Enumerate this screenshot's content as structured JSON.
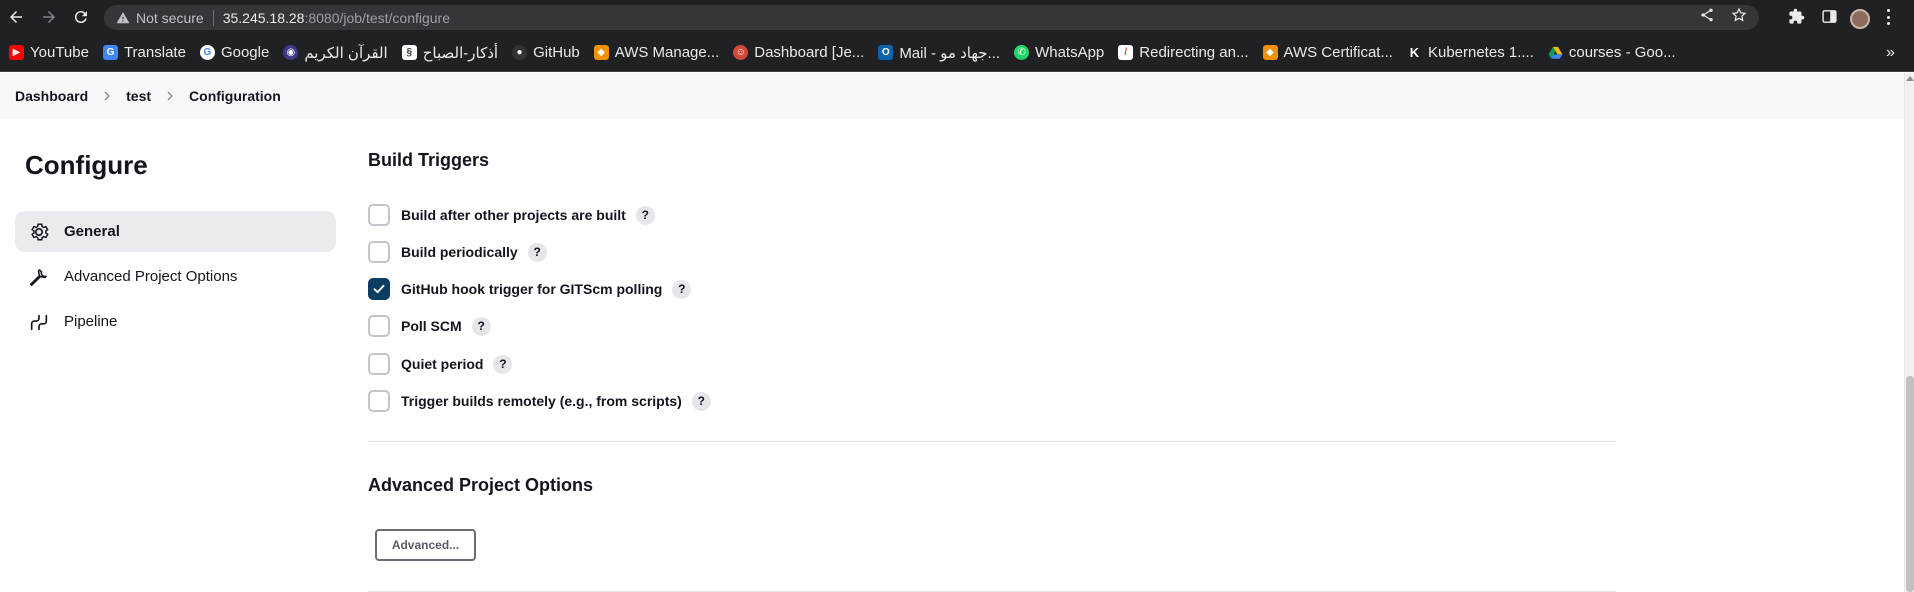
{
  "browser": {
    "not_secure_label": "Not secure",
    "url_host": "35.245.18.28",
    "url_rest": ":8080/job/test/configure",
    "bookmarks": [
      {
        "label": "YouTube",
        "icon": "youtube-icon",
        "color": "#ff0000"
      },
      {
        "label": "Translate",
        "icon": "translate-icon",
        "color": "#4285f4"
      },
      {
        "label": "Google",
        "icon": "google-icon",
        "color": "#ffffff"
      },
      {
        "label": "القرآن الكريم",
        "icon": "quran-icon",
        "color": "#3d3a8a"
      },
      {
        "label": "أذكار-الصباح",
        "icon": "azkar-icon",
        "color": "#ffffff"
      },
      {
        "label": "GitHub",
        "icon": "github-icon",
        "color": "#333333"
      },
      {
        "label": "AWS Manage...",
        "icon": "aws-icon",
        "color": "#f29100"
      },
      {
        "label": "Dashboard [Je...",
        "icon": "jenkins-icon",
        "color": "#d24939"
      },
      {
        "label": "Mail - جهاد مو...",
        "icon": "outlook-icon",
        "color": "#0a64ad"
      },
      {
        "label": "WhatsApp",
        "icon": "whatsapp-icon",
        "color": "#25d366"
      },
      {
        "label": "Redirecting an...",
        "icon": "redirect-icon",
        "color": "#e23a2e"
      },
      {
        "label": "AWS Certificat...",
        "icon": "aws-cert-icon",
        "color": "#f29100"
      },
      {
        "label": "Kubernetes 1....",
        "icon": "kubernetes-icon",
        "color": "#202124"
      },
      {
        "label": "courses - Goo...",
        "icon": "google-drive-icon",
        "color": "#0f9d58"
      }
    ],
    "bookmarks_more": "»"
  },
  "breadcrumb": {
    "items": [
      "Dashboard",
      "test",
      "Configuration"
    ]
  },
  "sidebar": {
    "title": "Configure",
    "items": [
      {
        "label": "General",
        "icon": "gear-icon",
        "active": true
      },
      {
        "label": "Advanced Project Options",
        "icon": "wrench-icon",
        "active": false
      },
      {
        "label": "Pipeline",
        "icon": "pipeline-icon",
        "active": false
      }
    ]
  },
  "build_triggers": {
    "title": "Build Triggers",
    "help": "?",
    "options": [
      {
        "label": "Build after other projects are built",
        "checked": false
      },
      {
        "label": "Build periodically",
        "checked": false
      },
      {
        "label": "GitHub hook trigger for GITScm polling",
        "checked": true
      },
      {
        "label": "Poll SCM",
        "checked": false
      },
      {
        "label": "Quiet period",
        "checked": false
      },
      {
        "label": "Trigger builds remotely (e.g., from scripts)",
        "checked": false
      }
    ]
  },
  "advanced_options": {
    "title": "Advanced Project Options",
    "button_label": "Advanced..."
  },
  "colors": {
    "accent": "#0b3d60",
    "chrome_bg": "#202124"
  }
}
